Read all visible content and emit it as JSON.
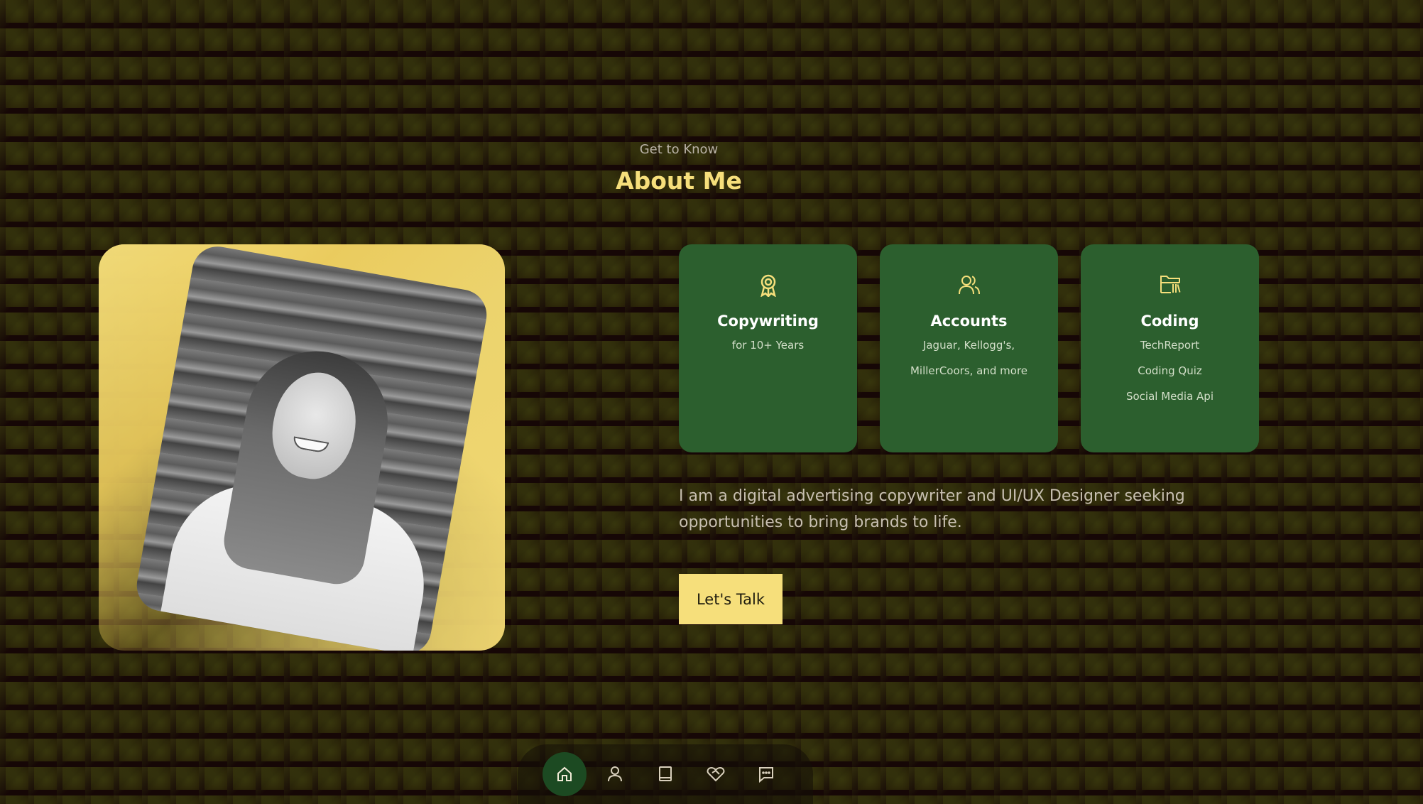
{
  "header": {
    "subtitle": "Get to Know",
    "title": "About Me"
  },
  "cards": [
    {
      "icon": "award-icon",
      "title": "Copywriting",
      "lines": [
        "for 10+ Years"
      ]
    },
    {
      "icon": "users-icon",
      "title": "Accounts",
      "lines": [
        "Jaguar, Kellogg's,",
        "MillerCoors, and more"
      ]
    },
    {
      "icon": "folder-library-icon",
      "title": "Coding",
      "lines": [
        "TechReport",
        "Coding Quiz",
        "Social Media Api"
      ]
    }
  ],
  "about": {
    "text": "I am a digital advertising copywriter and UI/UX Designer seeking opportunities to bring brands to life."
  },
  "cta": {
    "label": "Let's Talk"
  },
  "nav": [
    {
      "icon": "home-icon",
      "active": true
    },
    {
      "icon": "user-icon",
      "active": false
    },
    {
      "icon": "book-icon",
      "active": false
    },
    {
      "icon": "handshake-heart-icon",
      "active": false
    },
    {
      "icon": "message-icon",
      "active": false
    }
  ],
  "colors": {
    "accent": "#f6df7b",
    "card": "#2c5f2e",
    "nav_active": "#1c4a22",
    "background": "#1a0a07"
  }
}
